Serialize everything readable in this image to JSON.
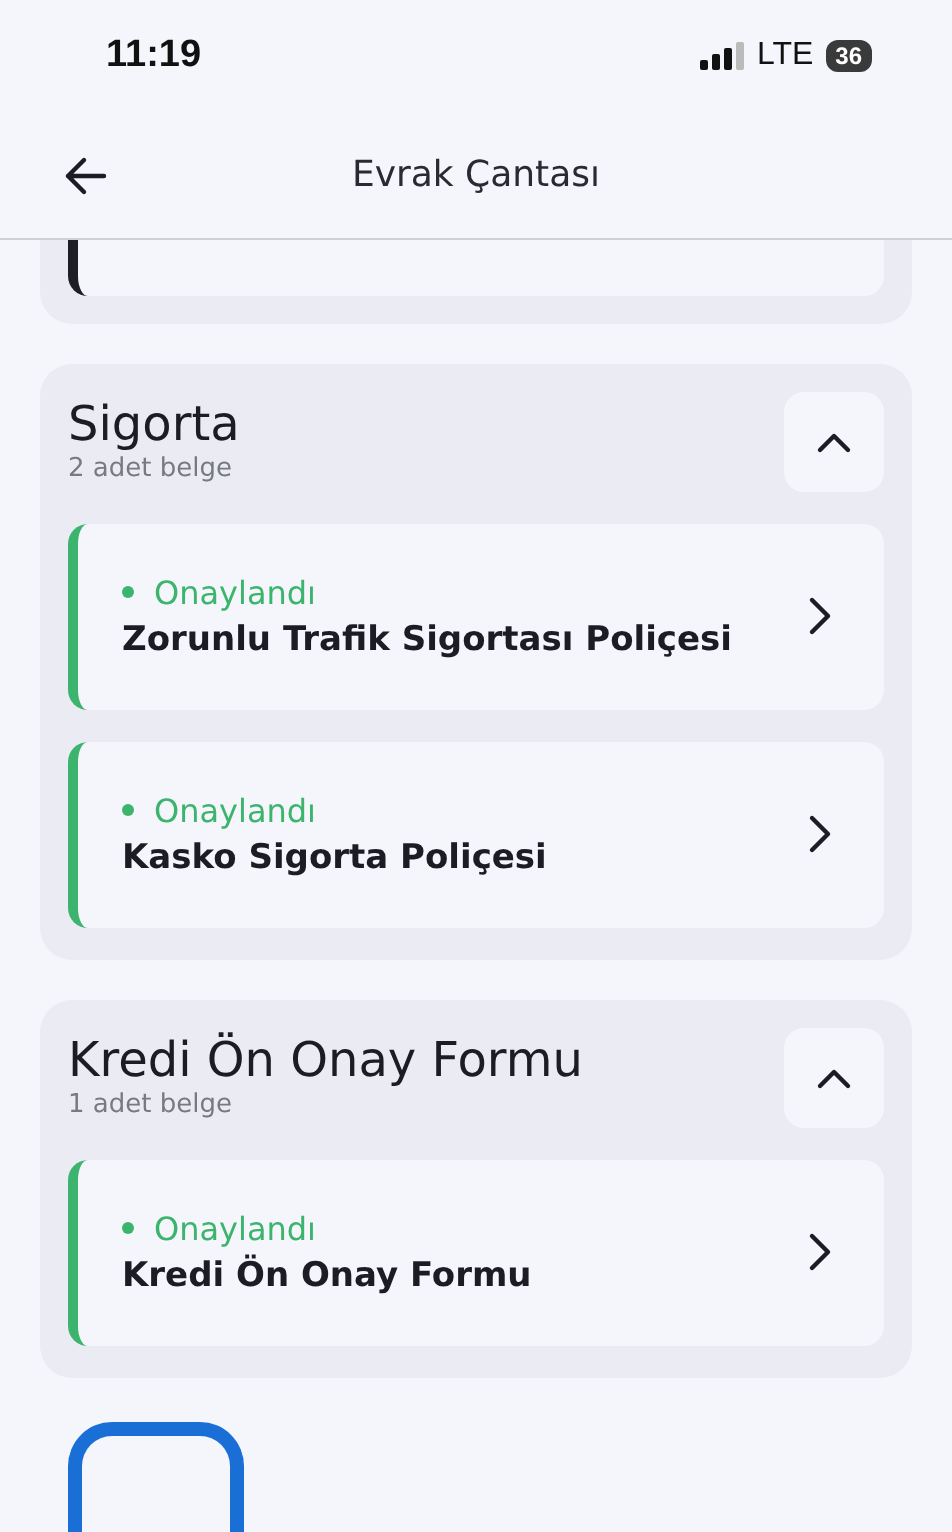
{
  "status_bar": {
    "time": "11:19",
    "network": "LTE",
    "battery": "36"
  },
  "header": {
    "title": "Evrak Çantası"
  },
  "cut_section": {
    "documents": [
      {
        "color": "#1e1e28"
      }
    ]
  },
  "sections": [
    {
      "title": "Sigorta",
      "count": "2 adet belge",
      "expanded": true,
      "documents": [
        {
          "status": "Onaylandı",
          "name": "Zorunlu Trafik Sigortası Poliçesi",
          "color": "#3cb46e"
        },
        {
          "status": "Onaylandı",
          "name": "Kasko Sigorta Poliçesi",
          "color": "#3cb46e"
        }
      ]
    },
    {
      "title": "Kredi Ön Onay Formu",
      "count": "1 adet belge",
      "expanded": true,
      "documents": [
        {
          "status": "Onaylandı",
          "name": "Kredi Ön Onay Formu",
          "color": "#3cb46e"
        }
      ]
    }
  ]
}
